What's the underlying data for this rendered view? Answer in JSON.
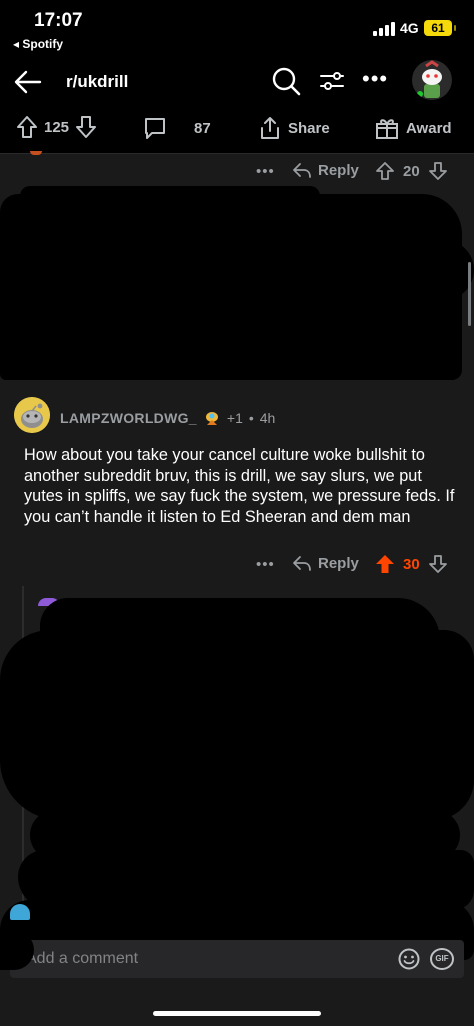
{
  "status": {
    "time": "17:07",
    "back_app": "◂ Spotify",
    "network": "4G",
    "battery": "61"
  },
  "nav": {
    "title": "r/ukdrill"
  },
  "post_actions": {
    "upvotes": "125",
    "comments": "87",
    "share": "Share",
    "award": "Award"
  },
  "comment_bar_1": {
    "reply": "Reply",
    "votes": "20"
  },
  "comment": {
    "username": "LAMPZWORLDWG_",
    "karma": "+1",
    "age": "4h",
    "body": "How about you take your cancel culture woke bullshit to another subreddit bruv, this is drill, we say slurs, we put yutes in spliffs, we say fuck the system, we pressure feds. If you can’t handle it listen to Ed Sheeran and dem man",
    "reply": "Reply",
    "votes": "30"
  },
  "add_comment": {
    "placeholder": "Add a comment",
    "gif": "GIF"
  },
  "colors": {
    "background": "#1a1a1b",
    "upvote_active": "#ff4500",
    "battery": "#f5d90a"
  }
}
